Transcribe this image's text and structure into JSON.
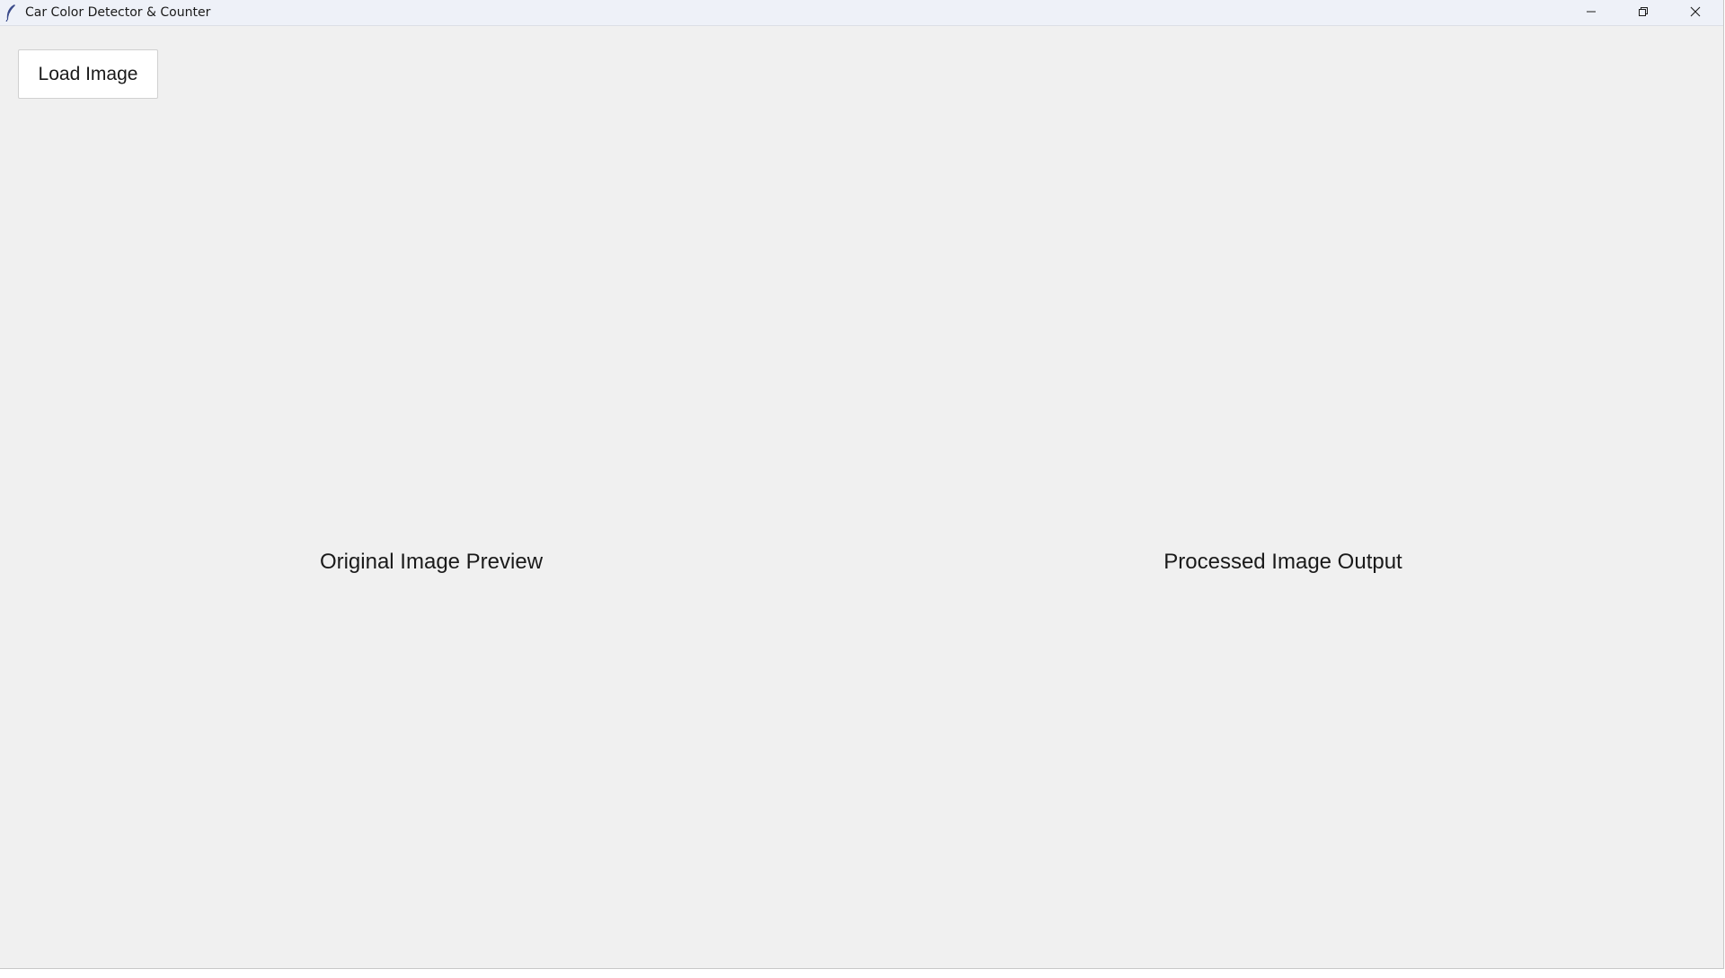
{
  "window": {
    "title": "Car Color Detector & Counter",
    "icon": "feather-icon",
    "controls": {
      "minimize_icon": "minimize-icon",
      "maximize_icon": "restore-icon",
      "close_icon": "close-icon"
    }
  },
  "toolbar": {
    "load_label": "Load Image"
  },
  "panels": {
    "original_label": "Original Image Preview",
    "processed_label": "Processed Image Output"
  },
  "colors": {
    "background": "#f0f0f0",
    "titlebar": "#eef1f8",
    "button_bg": "#ffffff",
    "text": "#1a1a1a"
  }
}
